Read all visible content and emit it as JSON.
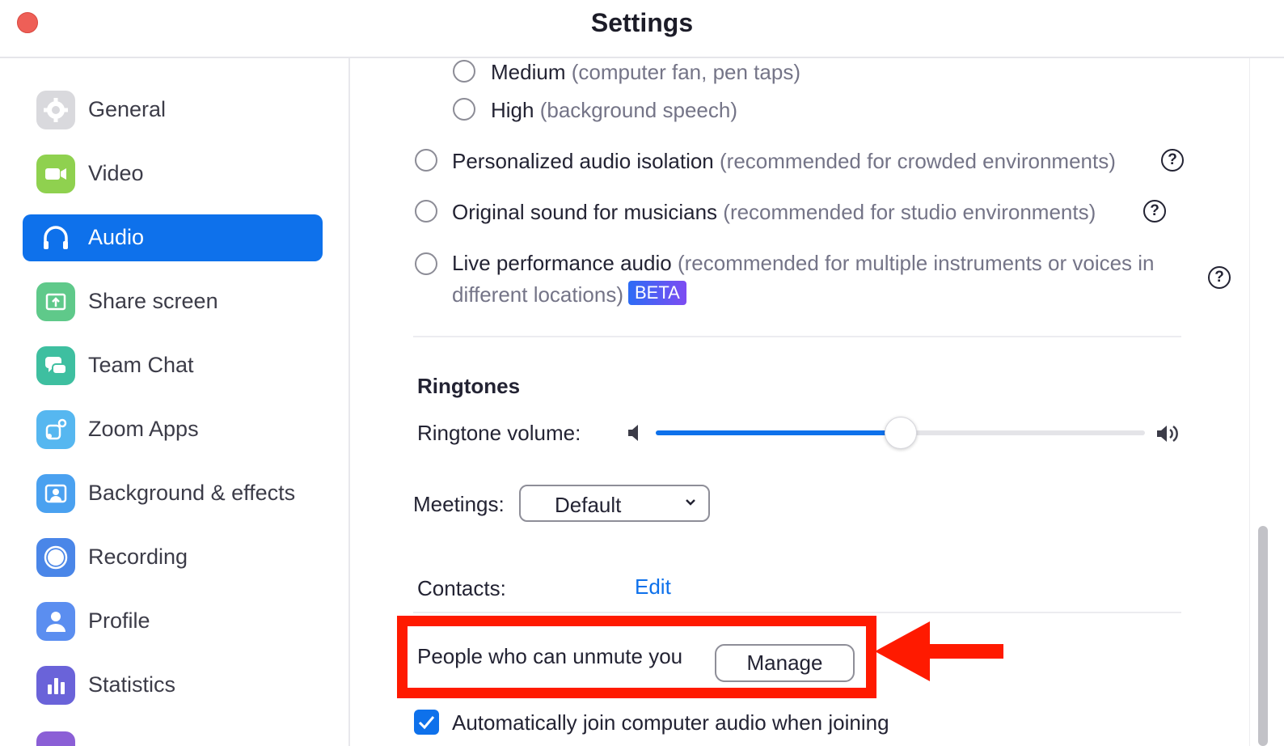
{
  "window": {
    "title": "Settings"
  },
  "sidebar": {
    "items": [
      {
        "label": "General",
        "icon": "gear-icon",
        "color": "#d4d4d8"
      },
      {
        "label": "Video",
        "icon": "video-camera-icon",
        "color": "#8fd14f"
      },
      {
        "label": "Audio",
        "icon": "headphones-icon",
        "color": "#0e71eb",
        "active": true
      },
      {
        "label": "Share screen",
        "icon": "share-screen-icon",
        "color": "#5fc98a"
      },
      {
        "label": "Team Chat",
        "icon": "chat-bubbles-icon",
        "color": "#3ebfa0"
      },
      {
        "label": "Zoom Apps",
        "icon": "apps-icon",
        "color": "#56b7f0"
      },
      {
        "label": "Background & effects",
        "icon": "background-icon",
        "color": "#4aa1f0"
      },
      {
        "label": "Recording",
        "icon": "recording-icon",
        "color": "#4a86e8"
      },
      {
        "label": "Profile",
        "icon": "person-icon",
        "color": "#5b8ef0"
      },
      {
        "label": "Statistics",
        "icon": "bar-chart-icon",
        "color": "#6a63d9"
      }
    ]
  },
  "audio": {
    "suppression_levels": [
      {
        "label": "Medium",
        "note": "(computer fan, pen taps)"
      },
      {
        "label": "High",
        "note": "(background speech)"
      }
    ],
    "modes": [
      {
        "label": "Personalized audio isolation",
        "note": "(recommended for crowded environments)"
      },
      {
        "label": "Original sound for musicians",
        "note": "(recommended for studio environments)"
      },
      {
        "label": "Live performance audio",
        "note_line1": "(recommended for multiple instruments or voices in",
        "note_line2": "different locations)",
        "badge": "BETA"
      }
    ],
    "help_glyph": "?",
    "ringtones": {
      "title": "Ringtones",
      "volume_label": "Ringtone volume:",
      "volume_level": 0.5,
      "meetings_label": "Meetings:",
      "meetings_value": "Default",
      "contacts_label": "Contacts:",
      "contacts_link": "Edit"
    },
    "unmute": {
      "label": "People who can unmute you",
      "button": "Manage"
    },
    "auto_join": {
      "label": "Automatically join computer audio when joining",
      "checked": true
    }
  },
  "annotation": {
    "color": "#ff1a00"
  }
}
